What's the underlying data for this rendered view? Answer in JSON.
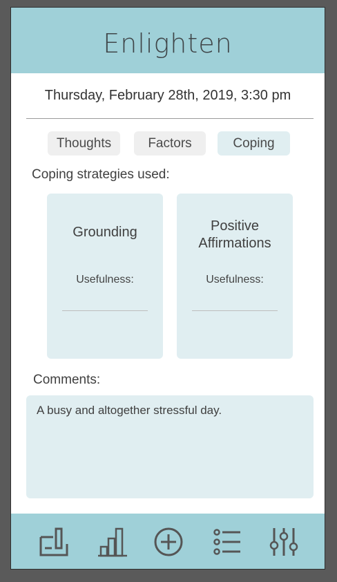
{
  "app": {
    "title": "Enlighten"
  },
  "entry": {
    "datetime": "Thursday, February 28th, 2019, 3:30 pm"
  },
  "tabs": [
    {
      "label": "Thoughts",
      "active": false
    },
    {
      "label": "Factors",
      "active": false
    },
    {
      "label": "Coping",
      "active": true
    }
  ],
  "coping": {
    "section_label": "Coping strategies used:",
    "cards": [
      {
        "title_line1": "Grounding",
        "title_line2": "",
        "usefulness_label": "Usefulness:",
        "usefulness_value": ""
      },
      {
        "title_line1": "Positive",
        "title_line2": "Affirmations",
        "usefulness_label": "Usefulness:",
        "usefulness_value": ""
      }
    ]
  },
  "comments": {
    "label": "Comments:",
    "value": "A busy and altogether stressful day."
  },
  "nav": {
    "items": [
      {
        "icon": "journal-entry-icon"
      },
      {
        "icon": "bar-chart-icon"
      },
      {
        "icon": "add-circle-icon"
      },
      {
        "icon": "list-icon"
      },
      {
        "icon": "sliders-icon"
      }
    ]
  },
  "colors": {
    "header": "#9fd0d8",
    "card": "#e0eef1",
    "tab_inactive": "#efefef",
    "frame": "#5a5a5a",
    "icon": "#555555"
  }
}
